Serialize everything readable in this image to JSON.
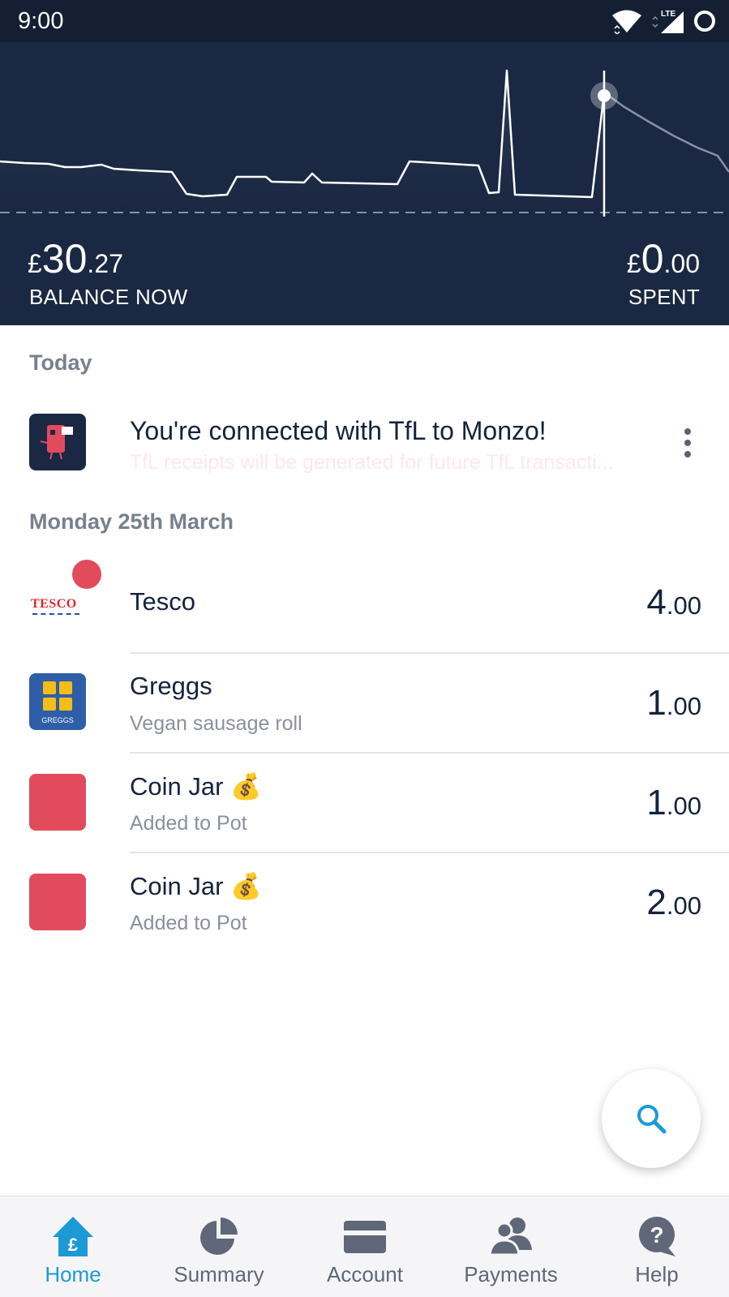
{
  "status_bar": {
    "time": "9:00",
    "network": "LTE"
  },
  "header": {
    "balance": {
      "currency": "£",
      "int": "30",
      "dec": ".27",
      "label": "BALANCE NOW"
    },
    "spent": {
      "currency": "£",
      "int": "0",
      "dec": ".00",
      "label": "SPENT"
    }
  },
  "feed": {
    "today_title": "Today",
    "notification": {
      "title": "You're connected with TfL to Monzo!",
      "subtitle": "TfL receipts will be generated for future TfL transacti..."
    },
    "date_title": "Monday 25th March",
    "transactions": [
      {
        "merchant": "Tesco",
        "logo_text": "TESCO",
        "note": "",
        "int": "4",
        "dec": ".00"
      },
      {
        "merchant": "Greggs",
        "logo_text": "GREGGS",
        "note": "Vegan sausage roll",
        "int": "1",
        "dec": ".00"
      },
      {
        "merchant": "Coin Jar 💰",
        "note": "Added to Pot",
        "int": "1",
        "dec": ".00"
      },
      {
        "merchant": "Coin Jar 💰",
        "note": "Added to Pot",
        "int": "2",
        "dec": ".00"
      }
    ]
  },
  "nav": {
    "items": [
      {
        "label": "Home",
        "icon": "home-icon",
        "active": true
      },
      {
        "label": "Summary",
        "icon": "pie-chart-icon",
        "active": false
      },
      {
        "label": "Account",
        "icon": "card-icon",
        "active": false
      },
      {
        "label": "Payments",
        "icon": "people-icon",
        "active": false
      },
      {
        "label": "Help",
        "icon": "help-icon",
        "active": false
      }
    ]
  },
  "colors": {
    "header_bg": "#1b2843",
    "status_bg": "#141f33",
    "accent": "#1c9ad6",
    "coral": "#e24b5c",
    "greggs_blue": "#2f5ea8",
    "greggs_yellow": "#f6bd16"
  }
}
